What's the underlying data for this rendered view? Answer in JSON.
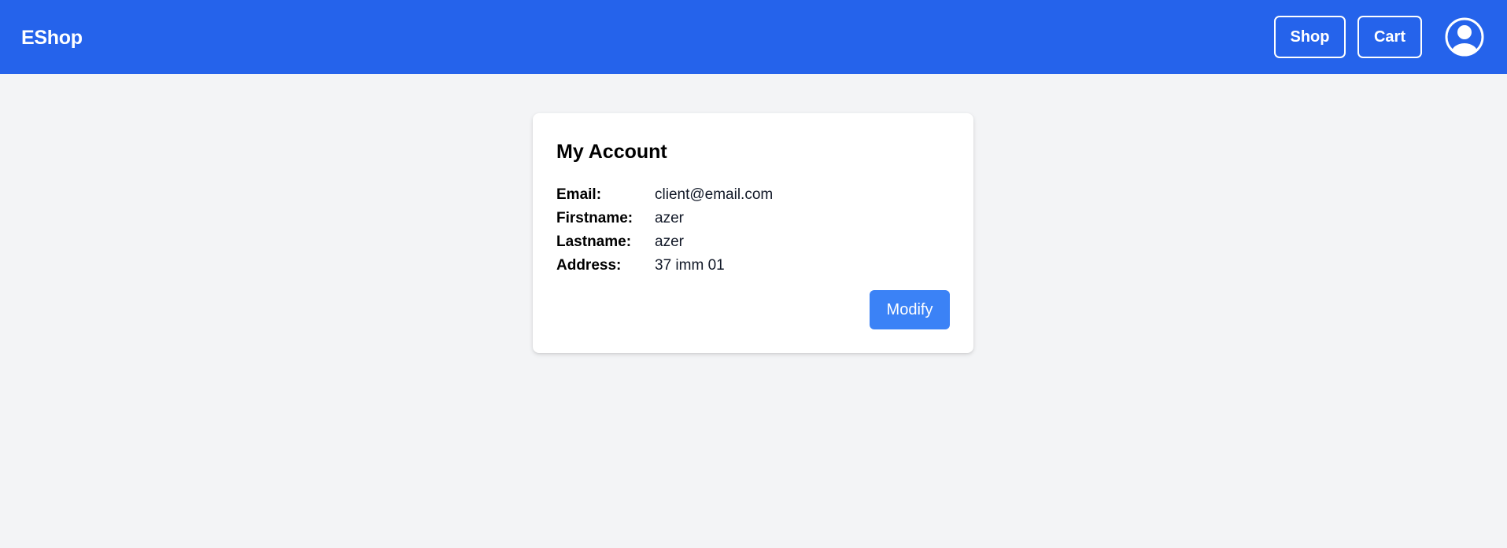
{
  "header": {
    "brand": "EShop",
    "nav": {
      "shop_label": "Shop",
      "cart_label": "Cart"
    },
    "account_icon": "user-circle-icon"
  },
  "account": {
    "title": "My Account",
    "fields": [
      {
        "label": "Email:",
        "value": "client@email.com"
      },
      {
        "label": "Firstname:",
        "value": "azer"
      },
      {
        "label": "Lastname:",
        "value": "azer"
      },
      {
        "label": "Address:",
        "value": "37 imm 01"
      }
    ],
    "modify_label": "Modify"
  },
  "colors": {
    "navbar": "#2563eb",
    "primary_button": "#3b82f6",
    "page_background": "#f3f4f6",
    "card_background": "#ffffff"
  }
}
